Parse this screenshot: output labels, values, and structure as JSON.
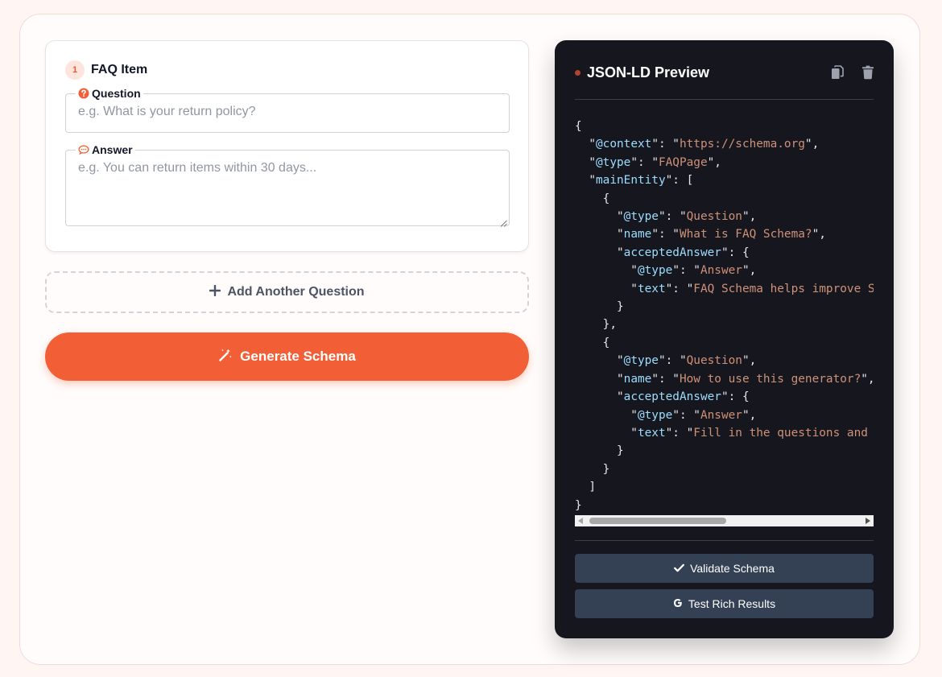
{
  "faq_item": {
    "number": "1",
    "title": "FAQ Item",
    "question_label": "Question",
    "question_placeholder": "e.g. What is your return policy?",
    "answer_label": "Answer",
    "answer_placeholder": "e.g. You can return items within 30 days..."
  },
  "actions": {
    "add_label": "Add Another Question",
    "generate_label": "Generate Schema"
  },
  "preview": {
    "title": "JSON-LD Preview",
    "validate_label": "Validate Schema",
    "test_label": "Test Rich Results",
    "json": {
      "context_key": "@context",
      "context_value": "https://schema.org",
      "type_key": "@type",
      "type_value": "FAQPage",
      "main_entity_key": "mainEntity",
      "name_key": "name",
      "accepted_answer_key": "acceptedAnswer",
      "text_key": "text",
      "question_type": "Question",
      "answer_type": "Answer",
      "entities": [
        {
          "name": "What is FAQ Schema?",
          "text": "FAQ Schema helps improve SEO by displaying FAQs in search results."
        },
        {
          "name": "How to use this generator?",
          "text": "Fill in the questions and answers, then click Generate Schema."
        }
      ]
    }
  },
  "colors": {
    "accent": "#f25f36",
    "panel_bg": "#16171e",
    "button_bg": "#344054"
  }
}
